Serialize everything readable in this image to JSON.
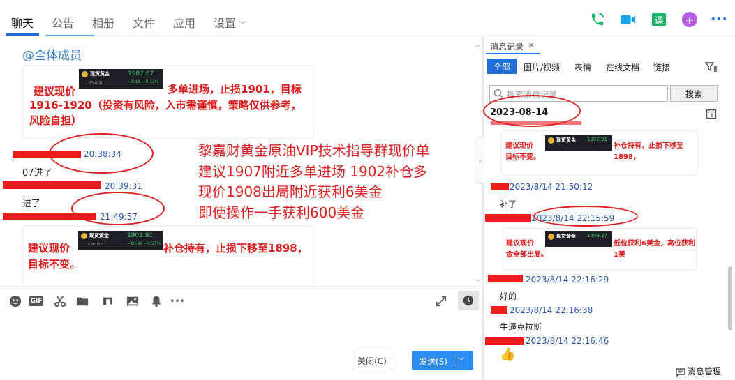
{
  "tabs": [
    {
      "label": "聊天",
      "active": true
    },
    {
      "label": "公告"
    },
    {
      "label": "相册"
    },
    {
      "label": "文件"
    },
    {
      "label": "应用"
    },
    {
      "label": "设置"
    }
  ],
  "top_icons": [
    "phone-icon",
    "video-call-icon",
    "course-icon",
    "add-app-icon",
    "more-icon"
  ],
  "top_icon_text": {
    "course": "课",
    "add": "+",
    "more": "•••"
  },
  "chat": {
    "mention": "@全体成员",
    "card1": {
      "line1_left": "建议现价",
      "line1_right": "多单进场，止损1901，目标",
      "line2": "1916-1920（投资有风险，入市需谨慎，策略仅供参考，",
      "line3": "风险自担）",
      "ticker_name": "现货黄金",
      "ticker_code": "XAUUSD",
      "ticker_price": "1907.67",
      "ticker_change": "−9.18  −0.32%"
    },
    "msg1_time": "20:38:34",
    "msg1_text": "07进了",
    "msg2_time": "20:39:31",
    "msg2_text": "进了",
    "msg3_time": "21:49:57",
    "card2": {
      "line1_left": "建议现价",
      "line1_right": "补仓持有，止损下移至1898，",
      "line2": "目标不变。",
      "ticker_name": "现货黄金",
      "ticker_code": "XAUUSD",
      "ticker_price": "1902.91",
      "ticker_change": "−10.92  −0.57%"
    },
    "overlay_lines": [
      "黎嘉财黄金原油VIP技术指导群现价单",
      "建议1907附近多单进场 1902补仓多",
      "现价1908出局附近获利6美金",
      "即使操作一手获利600美金"
    ]
  },
  "toolbar": {
    "icons": [
      "emoji-icon",
      "gif-icon",
      "scissors-icon",
      "folder-icon",
      "music-icon",
      "image-icon",
      "bell-icon",
      "more-icon"
    ],
    "gif_label": "GIF",
    "more_label": "•••"
  },
  "buttons": {
    "close": "关闭(C)",
    "send": "发送(S)"
  },
  "history": {
    "title": "消息记录",
    "close_glyph": "✕",
    "filters": [
      "全部",
      "图片/视频",
      "表情",
      "在线文档",
      "链接"
    ],
    "search_placeholder": "搜索消息记录",
    "search_button": "搜索",
    "date": "2023-08-14",
    "card1": {
      "line1_left": "建议现价",
      "line1_right": "补仓持有，止损下移至1898，",
      "line2": "目标不变。",
      "ticker_name": "现货黄金",
      "ticker_price": "1902.91"
    },
    "entries": [
      {
        "time": "2023/8/14 21:50:12",
        "text": "补了"
      },
      {
        "time": "2023/8/14 22:15:59",
        "text": ""
      },
      {
        "time": "2023/8/14 22:16:29",
        "text": "好的"
      },
      {
        "time": "2023/8/14 22:16:38",
        "text": "牛逼克拉斯"
      },
      {
        "time": "2023/8/14 22:16:46",
        "text": ""
      }
    ],
    "card2": {
      "line1_left": "建议现价",
      "line1_right": "低位获利6美金，高位获利1美",
      "line2": "金全部出局。",
      "ticker_name": "现货黄金",
      "ticker_price": "1908.37"
    },
    "manage_label": "消息管理"
  },
  "colors": {
    "accent": "#1e6fd9",
    "red": "#e02020",
    "time_blue": "#2b56b5",
    "send": "#2d8cf0"
  }
}
